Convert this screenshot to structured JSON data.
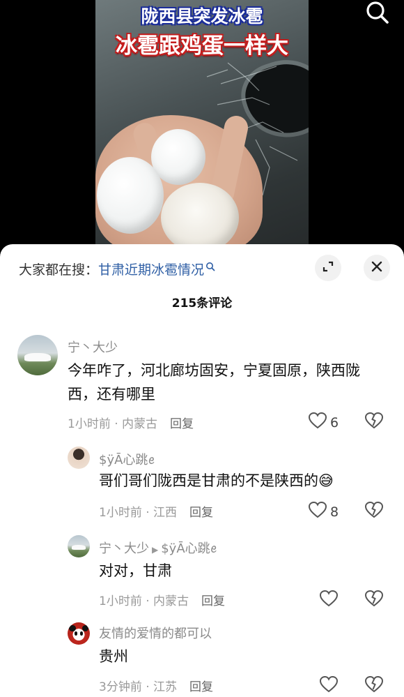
{
  "video": {
    "title_line1": "陇西县突发冰雹",
    "title_line2": "冰雹跟鸡蛋一样大"
  },
  "sheet": {
    "hot_search_prefix": "大家都在搜：",
    "hot_search_query": "甘肃近期冰雹情况",
    "comment_count": "215条评论"
  },
  "comments": [
    {
      "name": "宁丶大少",
      "text": "今年咋了，河北廊坊固安，宁夏固原，陕西陇西，还有哪里",
      "time": "1小时前 · 内蒙古",
      "reply": "回复",
      "likes": "6"
    },
    {
      "name": "$ÿĀ心跳ꫀ",
      "text": "哥们哥们陇西是甘肃的不是陕西的😅",
      "time": "1小时前 · 江西",
      "reply": "回复",
      "likes": "8"
    },
    {
      "name": "宁丶大少",
      "reply_to": "$ÿĀ心跳ꫀ",
      "text": "对对，甘肃",
      "time": "1小时前 · 内蒙古",
      "reply": "回复",
      "likes": ""
    },
    {
      "name": "友情的爱情的都可以",
      "text": "贵州",
      "time": "3分钟前 · 江苏",
      "reply": "回复",
      "likes": ""
    }
  ]
}
